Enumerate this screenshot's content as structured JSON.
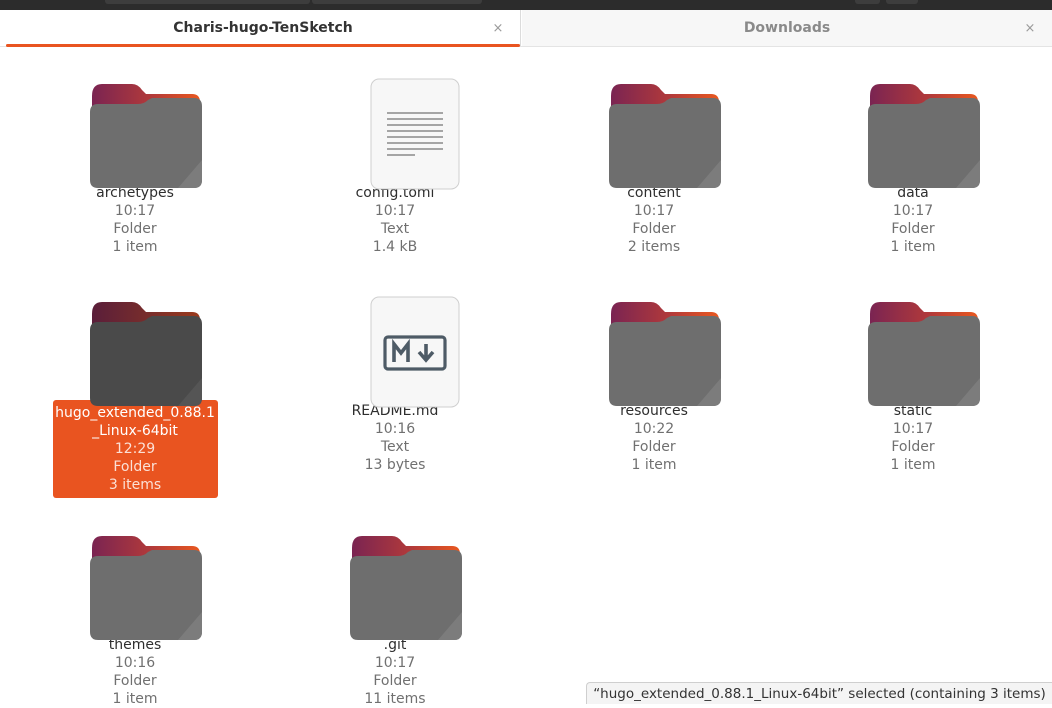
{
  "tabs": [
    {
      "label": "Charis-hugo-TenSketch",
      "close_icon": "close-icon"
    },
    {
      "label": "Downloads",
      "close_icon": "close-icon"
    }
  ],
  "tab_close_glyph": "×",
  "files": [
    {
      "name": "archetypes",
      "time": "10:17",
      "kind": "Folder",
      "info": "1 item",
      "icon": "folder-icon"
    },
    {
      "name": "config.toml",
      "time": "10:17",
      "kind": "Text",
      "info": "1.4 kB",
      "icon": "text-document-icon"
    },
    {
      "name": "content",
      "time": "10:17",
      "kind": "Folder",
      "info": "2 items",
      "icon": "folder-icon"
    },
    {
      "name": "data",
      "time": "10:17",
      "kind": "Folder",
      "info": "1 item",
      "icon": "folder-icon"
    },
    {
      "name": "hugo_extended_0.88.1_Linux-64bit",
      "time": "12:29",
      "kind": "Folder",
      "info": "3 items",
      "icon": "folder-icon",
      "selected": true
    },
    {
      "name": "README.md",
      "time": "10:16",
      "kind": "Text",
      "info": "13 bytes",
      "icon": "markdown-document-icon"
    },
    {
      "name": "resources",
      "time": "10:22",
      "kind": "Folder",
      "info": "1 item",
      "icon": "folder-icon"
    },
    {
      "name": "static",
      "time": "10:17",
      "kind": "Folder",
      "info": "1 item",
      "icon": "folder-icon"
    },
    {
      "name": "themes",
      "time": "10:16",
      "kind": "Folder",
      "info": "1 item",
      "icon": "folder-icon"
    },
    {
      "name": ".git",
      "time": "10:17",
      "kind": "Folder",
      "info": "11 items",
      "icon": "folder-icon"
    }
  ],
  "statusbar": {
    "text": "“hugo_extended_0.88.1_Linux-64bit” selected  (containing 3 items)"
  },
  "colors": {
    "accent": "#e95420",
    "folder_body": "#6e6e6e",
    "folder_back": "#8b2b56"
  }
}
